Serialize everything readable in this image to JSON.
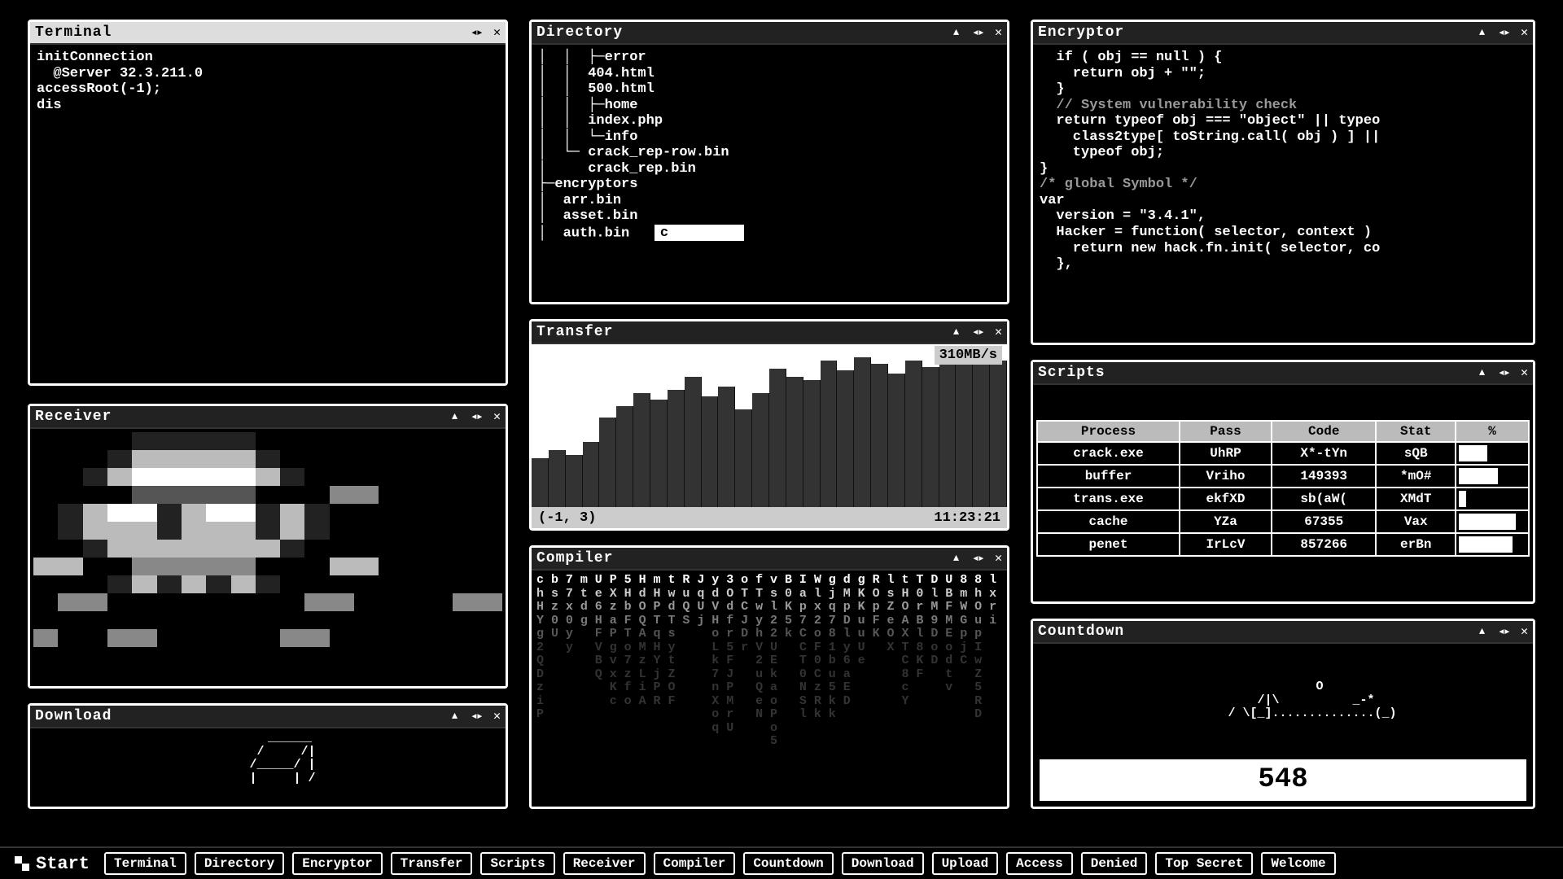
{
  "terminal": {
    "title": "Terminal",
    "lines": "initConnection\n  @Server 32.3.211.0\naccessRoot(-1);\ndis"
  },
  "directory": {
    "title": "Directory",
    "tree": [
      "│  │  ├─error",
      "│  │  404.html",
      "│  │  500.html",
      "│  │  ├─home",
      "│  │  index.php",
      "│  │  └─info",
      "│  └─ crack_rep-row.bin",
      "│     crack_rep.bin",
      "├─encryptors",
      "│  arr.bin",
      "│  asset.bin",
      "│  auth.bin"
    ],
    "input_value": "c"
  },
  "encryptor": {
    "title": "Encryptor",
    "code": "  if ( obj == null ) {\n    return obj + \"\";\n  }\n  // System vulnerability check\n  return typeof obj === \"object\" || typeo\n    class2type[ toString.call( obj ) ] ||\n    typeof obj;\n}\n/* global Symbol */\nvar\n  version = \"3.4.1\",\n  Hacker = function( selector, context )\n    return new hack.fn.init( selector, co\n  },"
  },
  "receiver": {
    "title": "Receiver"
  },
  "transfer": {
    "title": "Transfer",
    "rate": "310MB/s",
    "coords": "(-1, 3)",
    "time": "11:23:21",
    "bars": [
      30,
      35,
      32,
      40,
      55,
      62,
      70,
      66,
      72,
      80,
      68,
      74,
      60,
      70,
      85,
      80,
      78,
      90,
      84,
      92,
      88,
      82,
      90,
      86,
      94,
      88,
      96,
      90
    ]
  },
  "compiler": {
    "title": "Compiler"
  },
  "scripts": {
    "title": "Scripts",
    "headers": [
      "Process",
      "Pass",
      "Code",
      "Stat",
      "%"
    ],
    "rows": [
      {
        "process": "crack.exe",
        "pass": "UhRP",
        "code": "X*-tYn",
        "stat": "sQB",
        "pct": 40
      },
      {
        "process": "buffer",
        "pass": "Vriho",
        "code": "149393",
        "stat": "*mO#",
        "pct": 55
      },
      {
        "process": "trans.exe",
        "pass": "ekfXD",
        "code": "sb(aW(",
        "stat": "XMdT",
        "pct": 10
      },
      {
        "process": "cache",
        "pass": "YZa",
        "code": "67355",
        "stat": "Vax",
        "pct": 80
      },
      {
        "process": "penet",
        "pass": "IrLcV",
        "code": "857266",
        "stat": "erBn",
        "pct": 75
      }
    ]
  },
  "countdown": {
    "title": "Countdown",
    "art": "          O\n         /|\\          _-*\n        / \\[_]..............(_)",
    "value": "548"
  },
  "download": {
    "title": "Download",
    "art": "      ______\n     /     /|\n    /_____/ |\n    |     | /"
  },
  "taskbar": {
    "start": "Start",
    "items": [
      "Terminal",
      "Directory",
      "Encryptor",
      "Transfer",
      "Scripts",
      "Receiver",
      "Compiler",
      "Countdown",
      "Download",
      "Upload",
      "Access",
      "Denied",
      "Top Secret",
      "Welcome"
    ]
  }
}
